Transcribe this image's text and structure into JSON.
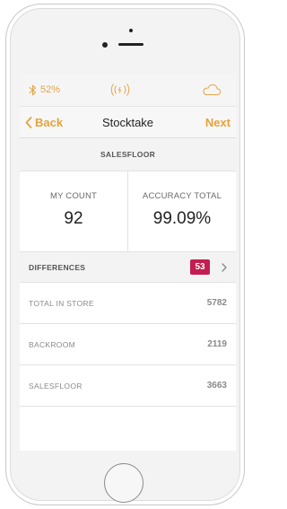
{
  "status_bar": {
    "bluetooth_icon": "bluetooth-icon",
    "battery_label": "52%",
    "rfid_icon": "rfid-signal-icon",
    "cloud_icon": "cloud-icon",
    "accent_color": "#e2a64a"
  },
  "nav": {
    "back_label": "Back",
    "title": "Stocktake",
    "next_label": "Next",
    "back_icon": "chevron-left-icon"
  },
  "section": {
    "title": "SALESFLOOR"
  },
  "stats": {
    "my_count_label": "MY COUNT",
    "my_count_value": "92",
    "accuracy_label": "ACCURACY TOTAL",
    "accuracy_value": "99.09%"
  },
  "differences": {
    "label": "DIFFERENCES",
    "count": "53",
    "badge_color": "#c41d4f",
    "chevron_icon": "chevron-right-icon"
  },
  "rows": [
    {
      "label": "TOTAL IN STORE",
      "value": "5782"
    },
    {
      "label": "BACKROOM",
      "value": "2119"
    },
    {
      "label": "SALESFLOOR",
      "value": "3663"
    }
  ]
}
